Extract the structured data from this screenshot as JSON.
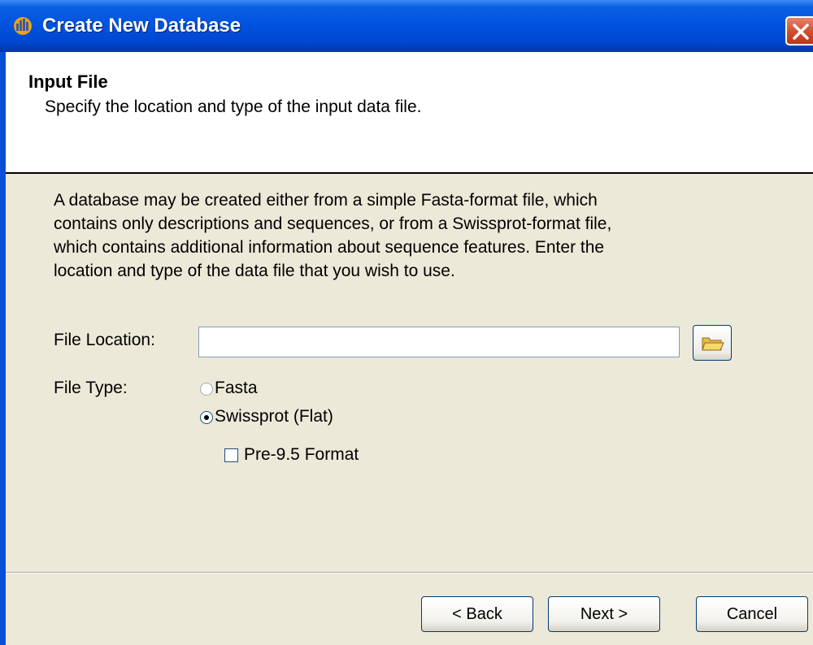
{
  "window": {
    "title": "Create New Database"
  },
  "header": {
    "title": "Input File",
    "subtitle": "Specify the location and type of the input data file."
  },
  "description": [
    "A database may be created either from a simple Fasta-format file, which",
    "contains only descriptions and sequences, or from a Swissprot-format file,",
    "which contains additional information about sequence features.  Enter the",
    "location and type of the data file that you wish to use."
  ],
  "form": {
    "file_location_label": "File Location:",
    "file_location_value": "",
    "file_type_label": "File Type:",
    "options": [
      {
        "label": "Fasta",
        "selected": false
      },
      {
        "label": "Swissprot (Flat)",
        "selected": true
      }
    ],
    "pre95_label": "Pre-9.5 Format",
    "pre95_checked": false
  },
  "buttons": {
    "back": "< Back",
    "next": "Next >",
    "cancel": "Cancel"
  },
  "icons": {
    "app": "app-icon",
    "close": "close-icon",
    "browse": "folder-icon"
  },
  "colors": {
    "titlebar": "#0052DE",
    "dialog_bg": "#ECE9D8",
    "header_bg": "#FFFFFF",
    "close_button": "#D14C2C"
  }
}
